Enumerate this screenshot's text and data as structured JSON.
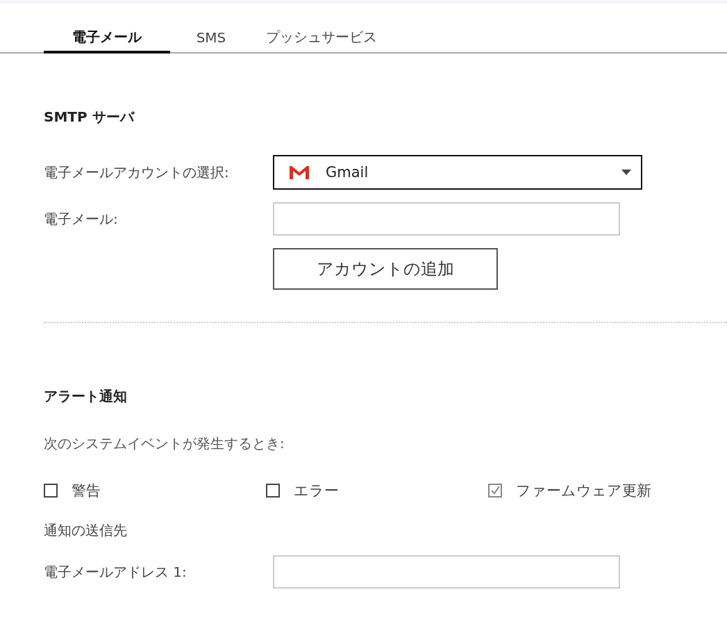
{
  "tabs": [
    {
      "label": "電子メール",
      "selected": true
    },
    {
      "label": "SMS",
      "selected": false
    },
    {
      "label": "プッシュサービス",
      "selected": false
    }
  ],
  "smtp_section": {
    "title": "SMTP サーバ",
    "account_select": {
      "label": "電子メールアカウントの選択:",
      "value": "Gmail"
    },
    "email_field": {
      "label": "電子メール:"
    },
    "add_account_button": "アカウントの追加"
  },
  "alert_section": {
    "title": "アラート通知",
    "description": "次のシステムイベントが発生するとき:",
    "events": [
      {
        "label": "警告",
        "checked": false
      },
      {
        "label": "エラー",
        "checked": false
      },
      {
        "label": "ファームウェア更新",
        "checked": true
      }
    ],
    "recipients_heading": "通知の送信先",
    "recipient_field": {
      "label": "電子メールアドレス 1:"
    }
  }
}
